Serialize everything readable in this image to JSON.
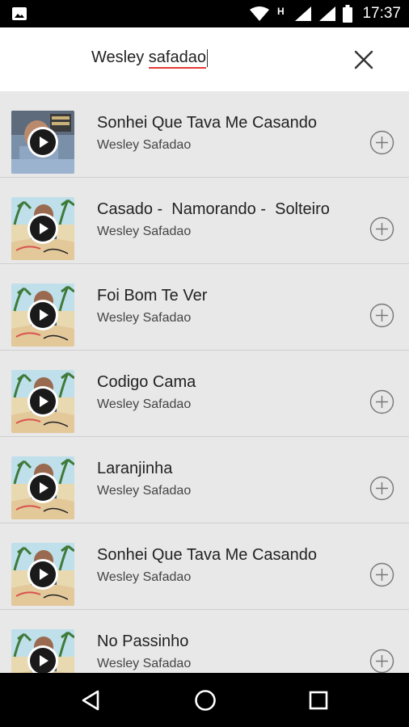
{
  "status_bar": {
    "time": "17:37",
    "icons": [
      "gallery-icon",
      "wifi-icon",
      "h-signal-icon",
      "signal-icon",
      "signal-icon",
      "battery-icon"
    ]
  },
  "search": {
    "query_word1": "Wesley ",
    "query_word2": "safadao"
  },
  "results": [
    {
      "title": "Sonhei Que Tava Me Casando",
      "artist": "Wesley Safadao",
      "cover": "cover-a"
    },
    {
      "title": "Casado -  Namorando -  Solteiro",
      "artist": "Wesley Safadao",
      "cover": "cover-b"
    },
    {
      "title": "Foi Bom Te Ver",
      "artist": "Wesley Safadao",
      "cover": "cover-b"
    },
    {
      "title": "Codigo Cama",
      "artist": "Wesley Safadao",
      "cover": "cover-b"
    },
    {
      "title": "Laranjinha",
      "artist": "Wesley Safadao",
      "cover": "cover-b"
    },
    {
      "title": "Sonhei Que Tava Me Casando",
      "artist": "Wesley Safadao",
      "cover": "cover-b"
    },
    {
      "title": "No Passinho",
      "artist": "Wesley Safadao",
      "cover": "cover-b"
    }
  ],
  "icons": {
    "close": "close-icon",
    "add": "add-circle-icon",
    "play": "play-icon",
    "back": "back-triangle-icon",
    "home": "home-circle-icon",
    "recents": "recents-square-icon"
  },
  "colors": {
    "accent_underline": "#e53935",
    "list_background": "#e8e8e8",
    "search_background": "#ffffff"
  }
}
